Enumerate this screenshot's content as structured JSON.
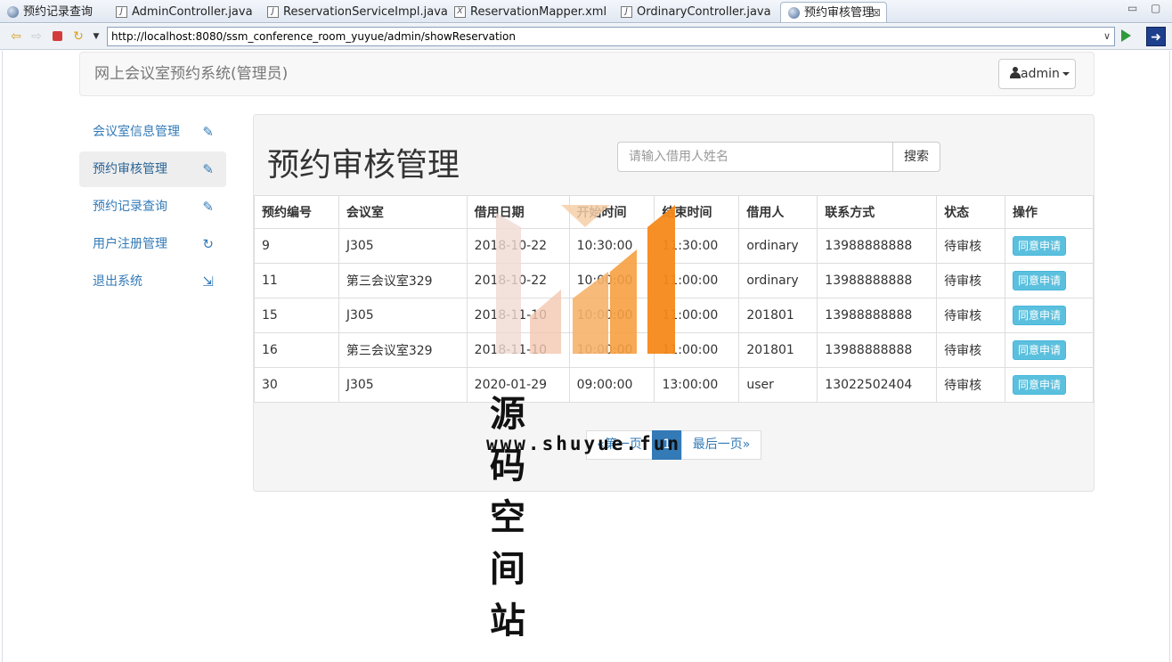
{
  "window": {
    "tabs": [
      {
        "label": "预约记录查询",
        "icon": "globe-icon"
      },
      {
        "label": "AdminController.java",
        "icon": "java-file-icon"
      },
      {
        "label": "ReservationServiceImpl.java",
        "icon": "java-file-icon"
      },
      {
        "label": "ReservationMapper.xml",
        "icon": "xml-file-icon"
      },
      {
        "label": "OrdinaryController.java",
        "icon": "java-file-icon"
      },
      {
        "label": "预约审核管理",
        "icon": "globe-icon"
      }
    ],
    "close_glyph": "⊠",
    "url": "http://localhost:8080/ssm_conference_room_yuyue/admin/showReservation"
  },
  "navbar": {
    "brand": "网上会议室预约系统(管理员)",
    "user": "admin"
  },
  "sidebar": {
    "items": [
      {
        "label": "会议室信息管理",
        "icon": "pencil-icon",
        "glyph": "✎"
      },
      {
        "label": "预约审核管理",
        "icon": "pencil-icon",
        "glyph": "✎"
      },
      {
        "label": "预约记录查询",
        "icon": "pencil-icon",
        "glyph": "✎"
      },
      {
        "label": "用户注册管理",
        "icon": "refresh-icon",
        "glyph": "↻"
      },
      {
        "label": "退出系统",
        "icon": "logout-icon",
        "glyph": "⇲"
      }
    ]
  },
  "main": {
    "title": "预约审核管理",
    "search_placeholder": "请输入借用人姓名",
    "search_button": "搜索",
    "table": {
      "headers": [
        "预约编号",
        "会议室",
        "借用日期",
        "开始时间",
        "结束时间",
        "借用人",
        "联系方式",
        "状态",
        "操作"
      ],
      "rows": [
        {
          "id": "9",
          "room": "J305",
          "date": "2018-10-22",
          "start": "10:30:00",
          "end": "11:30:00",
          "user": "ordinary",
          "phone": "13988888888",
          "status": "待审核",
          "action": "同意申请"
        },
        {
          "id": "11",
          "room": "第三会议室329",
          "date": "2018-10-22",
          "start": "10:00:00",
          "end": "11:00:00",
          "user": "ordinary",
          "phone": "13988888888",
          "status": "待审核",
          "action": "同意申请"
        },
        {
          "id": "15",
          "room": "J305",
          "date": "2018-11-10",
          "start": "10:00:00",
          "end": "11:00:00",
          "user": "201801",
          "phone": "13988888888",
          "status": "待审核",
          "action": "同意申请"
        },
        {
          "id": "16",
          "room": "第三会议室329",
          "date": "2018-11-10",
          "start": "10:00:00",
          "end": "11:00:00",
          "user": "201801",
          "phone": "13988888888",
          "status": "待审核",
          "action": "同意申请"
        },
        {
          "id": "30",
          "room": "J305",
          "date": "2020-01-29",
          "start": "09:00:00",
          "end": "13:00:00",
          "user": "user",
          "phone": "13022502404",
          "status": "待审核",
          "action": "同意申请"
        }
      ]
    },
    "pagination": {
      "first": "«第一页",
      "current": "1",
      "last": "最后一页»"
    }
  },
  "watermark": {
    "title": "源码空间站",
    "url": "www.shuyue.fun",
    "colors": [
      "#f0d9d2",
      "#f6b36a",
      "#f4891a"
    ]
  }
}
